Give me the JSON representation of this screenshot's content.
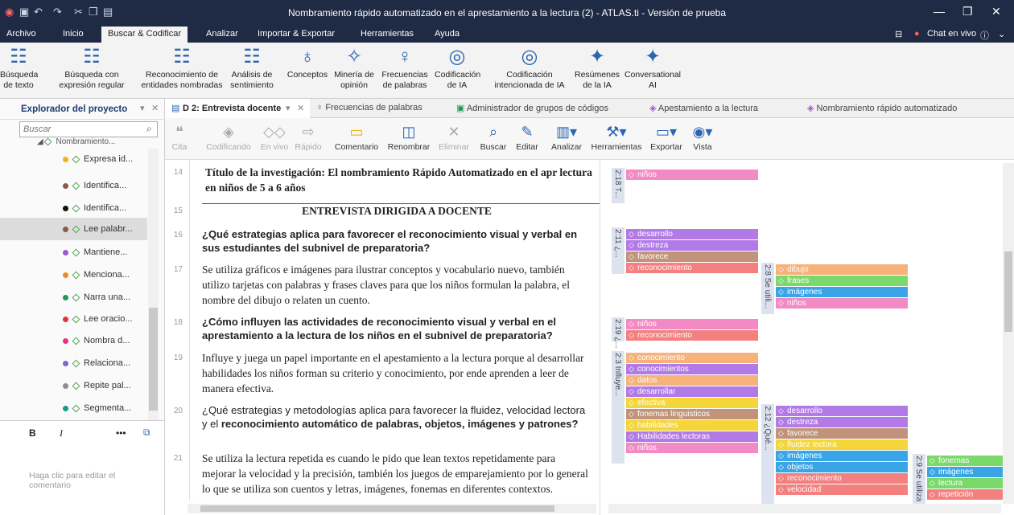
{
  "window": {
    "title": "Nombramiento rápido automatizado en el aprestamiento a la lectura (2) - ATLAS.ti - Versión de prueba"
  },
  "menu": [
    "Archivo",
    "Inicio",
    "Buscar & Codificar",
    "Analizar",
    "Importar & Exportar",
    "Herramientas",
    "Ayuda"
  ],
  "menu_right": {
    "chat": "Chat en vivo"
  },
  "ribbon": [
    {
      "label": "Búsqueda\nde texto",
      "icon": "text-search-icon"
    },
    {
      "label": "Búsqueda con\nexpresión regular",
      "icon": "regex-search-icon"
    },
    {
      "label": "Reconocimiento de\nentidades nombradas",
      "icon": "entity-icon"
    },
    {
      "label": "Análisis de\nsentimiento",
      "icon": "sentiment-icon"
    },
    {
      "label": "Conceptos",
      "icon": "bulb-icon"
    },
    {
      "label": "Minería de\nopinión",
      "icon": "opinion-icon"
    },
    {
      "label": "Frecuencias\nde palabras",
      "icon": "frequency-icon"
    },
    {
      "label": "Codificación\nde IA",
      "icon": "ai-coding-icon"
    },
    {
      "label": "Codificación\nintencionada de IA",
      "icon": "intent-coding-icon"
    },
    {
      "label": "Resúmenes\nde la IA",
      "icon": "ai-summary-icon"
    },
    {
      "label": "Conversational\nAI",
      "icon": "conversational-icon"
    }
  ],
  "explorer": {
    "title": "Explorador del proyecto",
    "search_placeholder": "Buscar",
    "parent": "Nombramiento...",
    "items": [
      {
        "label": "Expresa id...",
        "color": "#f2b21b"
      },
      {
        "label": "Identifica...",
        "color": "#8a5a44"
      },
      {
        "label": "Identifica...",
        "color": "#111111"
      },
      {
        "label": "Lee palabr...",
        "color": "#8a5a44"
      },
      {
        "label": "Mantiene...",
        "color": "#9b59d0"
      },
      {
        "label": "Menciona...",
        "color": "#f08a24"
      },
      {
        "label": "Narra una...",
        "color": "#1a9a5a"
      },
      {
        "label": "Lee oracio...",
        "color": "#e53333"
      },
      {
        "label": "Nombra d...",
        "color": "#e8337a"
      },
      {
        "label": "Relaciona...",
        "color": "#7a6ad0"
      },
      {
        "label": "Repite pal...",
        "color": "#8e8e8e"
      },
      {
        "label": "Segmenta...",
        "color": "#1a9a8a"
      }
    ],
    "comment_placeholder": "Haga clic para editar el\ncomentario"
  },
  "tabs": [
    "D 2: Entrevista docente",
    "Frecuencias de palabras",
    "Administrador de grupos de códigos",
    "Apestamiento a la lectura",
    "Nombramiento rápido automatizado"
  ],
  "doc_toolbar": [
    {
      "label": "Cita",
      "icon": "quote-icon",
      "enabled": false
    },
    {
      "label": "Codificando",
      "icon": "coding-icon",
      "enabled": false
    },
    {
      "label": "En vivo",
      "icon": "live-icon",
      "enabled": false
    },
    {
      "label": "Rápido",
      "icon": "quick-icon",
      "enabled": false
    },
    {
      "label": "Comentario",
      "icon": "comment-icon",
      "enabled": true
    },
    {
      "label": "Renombrar",
      "icon": "rename-icon",
      "enabled": true
    },
    {
      "label": "Eliminar",
      "icon": "delete-icon",
      "enabled": false
    },
    {
      "label": "Buscar",
      "icon": "search-icon",
      "enabled": true
    },
    {
      "label": "Editar",
      "icon": "edit-icon",
      "enabled": true
    },
    {
      "label": "Analizar",
      "icon": "analyze-icon",
      "enabled": true
    },
    {
      "label": "Herramientas",
      "icon": "tools-icon",
      "enabled": true
    },
    {
      "label": "Exportar",
      "icon": "export-icon",
      "enabled": true
    },
    {
      "label": "Vista",
      "icon": "eye-icon",
      "enabled": true
    }
  ],
  "document": [
    {
      "n": "14",
      "style": "serif-bold",
      "text": "Título de la investigación:  El nombramiento Rápido Automatizado en el apr lectura en niños de 5 a 6 años"
    },
    {
      "n": "15",
      "style": "serif-bold-center",
      "text": "ENTREVISTA DIRIGIDA A DOCENTE"
    },
    {
      "n": "16",
      "style": "sans-bold",
      "text": "¿Qué estrategias aplica para favorecer el reconocimiento visual y verbal en sus estudiantes del subnivel de preparatoria?"
    },
    {
      "n": "17",
      "style": "serif",
      "text": "Se utiliza gráficos e imágenes para ilustrar conceptos y vocabulario nuevo, también utilizo tarjetas con palabras y frases claves para que los niños formulan la palabra, el nombre del dibujo o relaten un cuento."
    },
    {
      "n": "18",
      "style": "sans-bold",
      "text": "¿Cómo influyen las actividades de reconocimiento visual y verbal en el aprestamiento a la lectura de los niños en el subnivel de preparatoria?"
    },
    {
      "n": "19",
      "style": "serif",
      "text": "Influye y juega un papel importante en el apestamiento a la lectura porque al desarrollar habilidades los niños forman su criterio y conocimiento, por ende aprenden a leer de manera efectiva."
    },
    {
      "n": "20",
      "style": "sans-mixed",
      "text": "¿Qué estrategias y metodologías aplica para favorecer la fluidez, velocidad lectora y el ",
      "bold": "reconocimiento automático de palabras, objetos, imágenes y patrones?"
    },
    {
      "n": "21",
      "style": "serif",
      "text": "Se utiliza la lectura repetida es cuando le pido que lean textos repetidamente para mejorar la velocidad y la precisión, también los juegos de emparejamiento por lo general lo que se utiliza son cuentos y letras, imágenes, fonemas en diferentes contextos."
    }
  ],
  "quotations": [
    {
      "label": "2:18 T...",
      "codes": [
        {
          "t": "niños",
          "c": "#f28ac4"
        }
      ]
    },
    {
      "label": "2:11 ¿...",
      "codes": [
        {
          "t": "desarrollo",
          "c": "#b27ae6"
        },
        {
          "t": "destreza",
          "c": "#b27ae6"
        },
        {
          "t": "favorece",
          "c": "#c0937a"
        },
        {
          "t": "reconocimiento",
          "c": "#f37f7f"
        }
      ]
    },
    {
      "label": "2:8 Se utili...",
      "codes": [
        {
          "t": "dibujo",
          "c": "#f6b27a"
        },
        {
          "t": "frases",
          "c": "#7ad96a"
        },
        {
          "t": "imágenes",
          "c": "#3aa5e6"
        },
        {
          "t": "niños",
          "c": "#f28ac4"
        }
      ]
    },
    {
      "label": "2:19 ¿...",
      "codes": [
        {
          "t": "niños",
          "c": "#f28ac4"
        },
        {
          "t": "reconocimiento",
          "c": "#f37f7f"
        }
      ]
    },
    {
      "label": "2:3 Influye...",
      "codes": [
        {
          "t": "conocimiento",
          "c": "#f6b27a"
        },
        {
          "t": "conocimientos",
          "c": "#b27ae6"
        },
        {
          "t": "datos",
          "c": "#f6b27a"
        },
        {
          "t": "desarrollar",
          "c": "#b27ae6"
        },
        {
          "t": "efectiva",
          "c": "#f5d63a"
        },
        {
          "t": "fonemas linguisticos",
          "c": "#c0937a"
        },
        {
          "t": "habilidades",
          "c": "#f5d63a"
        },
        {
          "t": "Habilidades lectoras",
          "c": "#b27ae6"
        },
        {
          "t": "niños",
          "c": "#f28ac4"
        }
      ]
    },
    {
      "label": "2:12 ¿Qué...",
      "codes": [
        {
          "t": "desarrollo",
          "c": "#b27ae6"
        },
        {
          "t": "destreza",
          "c": "#b27ae6"
        },
        {
          "t": "favorece",
          "c": "#c0937a"
        },
        {
          "t": "fluidez lectora",
          "c": "#f5d63a"
        },
        {
          "t": "imágenes",
          "c": "#3aa5e6"
        },
        {
          "t": "objetos",
          "c": "#3aa5e6"
        },
        {
          "t": "reconocimiento",
          "c": "#f37f7f"
        },
        {
          "t": "velocidad",
          "c": "#f37f7f"
        }
      ]
    },
    {
      "label": "2:9 Se utiliza",
      "codes": [
        {
          "t": "fonemas",
          "c": "#7ad96a"
        },
        {
          "t": "imágenes",
          "c": "#3aa5e6"
        },
        {
          "t": "lectura",
          "c": "#7ad96a"
        },
        {
          "t": "repetición",
          "c": "#f37f7f"
        }
      ]
    }
  ]
}
